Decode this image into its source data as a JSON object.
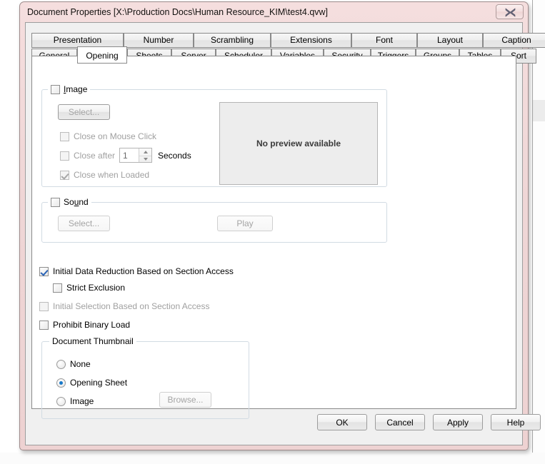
{
  "window": {
    "title": "Document Properties [X:\\Production Docs\\Human Resource_KIM\\test4.qvw]",
    "close_label": "Close"
  },
  "tabs": {
    "row_top": [
      {
        "label": "Presentation",
        "active": false
      },
      {
        "label": "Number",
        "active": false
      },
      {
        "label": "Scrambling",
        "active": false
      },
      {
        "label": "Extensions",
        "active": false
      },
      {
        "label": "Font",
        "active": false
      },
      {
        "label": "Layout",
        "active": false
      },
      {
        "label": "Caption",
        "active": false
      }
    ],
    "row_bottom": [
      {
        "label": "General",
        "active": false
      },
      {
        "label": "Opening",
        "active": true
      },
      {
        "label": "Sheets",
        "active": false
      },
      {
        "label": "Server",
        "active": false
      },
      {
        "label": "Scheduler",
        "active": false
      },
      {
        "label": "Variables",
        "active": false
      },
      {
        "label": "Security",
        "active": false
      },
      {
        "label": "Triggers",
        "active": false
      },
      {
        "label": "Groups",
        "active": false
      },
      {
        "label": "Tables",
        "active": false
      },
      {
        "label": "Sort",
        "active": false
      }
    ]
  },
  "image_group": {
    "legend": "Image",
    "checked": false,
    "select_button": "Select...",
    "close_on_mouse_click": {
      "label": "Close on Mouse Click",
      "checked": false,
      "enabled": false
    },
    "close_after": {
      "label": "Close after",
      "checked": false,
      "enabled": false
    },
    "seconds_value": "1",
    "seconds_label": "Seconds",
    "close_when_loaded": {
      "label": "Close when Loaded",
      "checked": true,
      "enabled": false
    },
    "preview_text": "No preview available"
  },
  "sound_group": {
    "legend": "Sound",
    "checked": false,
    "select_button": "Select...",
    "play_button": "Play"
  },
  "options": {
    "initial_data_reduction": {
      "label": "Initial Data Reduction Based on Section Access",
      "checked": true,
      "enabled": true
    },
    "strict_exclusion": {
      "label": "Strict Exclusion",
      "checked": false,
      "enabled": true
    },
    "initial_selection": {
      "label": "Initial Selection Based on Section Access",
      "checked": false,
      "enabled": false
    },
    "prohibit_binary_load": {
      "label": "Prohibit Binary Load",
      "checked": false,
      "enabled": true
    }
  },
  "thumbnail_group": {
    "legend": "Document Thumbnail",
    "options": [
      {
        "label": "None",
        "selected": false
      },
      {
        "label": "Opening Sheet",
        "selected": true
      },
      {
        "label": "Image",
        "selected": false
      }
    ],
    "browse_button": "Browse..."
  },
  "footer": {
    "ok": "OK",
    "cancel": "Cancel",
    "apply": "Apply",
    "help": "Help"
  },
  "colors": {
    "accent_check": "#2a63b5",
    "accent_radio": "#1878c8",
    "frame": "#efd6d6"
  }
}
